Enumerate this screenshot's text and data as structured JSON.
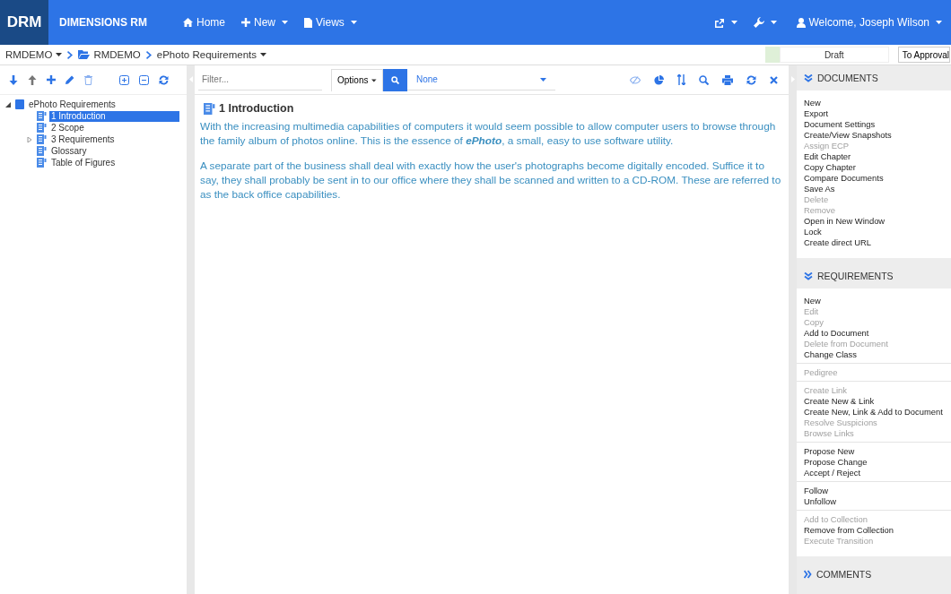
{
  "app": {
    "logo": "DRM",
    "product": "DIMENSIONS RM"
  },
  "nav": [
    {
      "kind": "home",
      "label": "Home",
      "dropdown": false
    },
    {
      "kind": "new",
      "label": "New",
      "dropdown": true
    },
    {
      "kind": "views",
      "label": "Views",
      "dropdown": true
    }
  ],
  "nav_right": [
    {
      "kind": "share",
      "dropdown": true
    },
    {
      "kind": "tools",
      "dropdown": true
    }
  ],
  "user": {
    "label": "Welcome, Joseph Wilson",
    "dropdown": true
  },
  "breadcrumb": [
    {
      "kind": "project",
      "label": "RMDEMO",
      "dropdown": true
    },
    {
      "kind": "folder",
      "label": "RMDEMO",
      "dropdown": false
    },
    {
      "kind": "document",
      "label": "ePhoto Requirements",
      "dropdown": true
    }
  ],
  "status": {
    "state": "Draft",
    "action": "To Approval",
    "color": "#dff0d8"
  },
  "tree": [
    {
      "label": "ePhoto Requirements",
      "expanded": true,
      "selected": false,
      "children": [
        {
          "label": "1 Introduction",
          "selected": true
        },
        {
          "label": "2 Scope",
          "selected": false
        },
        {
          "label": "3 Requirements",
          "expanded": false,
          "selected": false
        },
        {
          "label": "Glossary",
          "selected": false
        },
        {
          "label": "Table of Figures",
          "selected": false
        }
      ]
    }
  ],
  "filter": {
    "placeholder": "Filter..."
  },
  "options_button": "Options",
  "view_select": "None",
  "content": {
    "heading": "1 Introduction",
    "paragraphs": [
      "With the increasing multimedia capabilities of computers it would seem possible to allow computer users to browse through the family album of photos online. This is the essence of *ePhoto*, a small, easy to use software utility.",
      "A separate part of the business shall deal with exactly how the user's photographs become digitally encoded. Suffice it to say, they shall probably be sent in to our office where they shall be scanned and written to a CD-ROM. These are referred to as the back office capabilities."
    ]
  },
  "panels": [
    {
      "title": "DOCUMENTS",
      "expanded": true,
      "groups": [
        [
          {
            "label": "New",
            "disabled": false
          },
          {
            "label": "Export",
            "disabled": false
          },
          {
            "label": "Document Settings",
            "disabled": false
          },
          {
            "label": "Create/View Snapshots",
            "disabled": false
          },
          {
            "label": "Assign ECP",
            "disabled": true
          },
          {
            "label": "Edit Chapter",
            "disabled": false
          },
          {
            "label": "Copy Chapter",
            "disabled": false
          },
          {
            "label": "Compare Documents",
            "disabled": false
          },
          {
            "label": "Save As",
            "disabled": false
          },
          {
            "label": "Delete",
            "disabled": true
          },
          {
            "label": "Remove",
            "disabled": true
          },
          {
            "label": "Open in New Window",
            "disabled": false
          },
          {
            "label": "Lock",
            "disabled": false
          },
          {
            "label": "Create direct URL",
            "disabled": false
          }
        ]
      ]
    },
    {
      "title": "REQUIREMENTS",
      "expanded": true,
      "groups": [
        [
          {
            "label": "New",
            "disabled": false
          },
          {
            "label": "Edit",
            "disabled": true
          },
          {
            "label": "Copy",
            "disabled": true
          },
          {
            "label": "Add to Document",
            "disabled": false
          },
          {
            "label": "Delete from Document",
            "disabled": true
          },
          {
            "label": "Change Class",
            "disabled": false
          }
        ],
        [
          {
            "label": "Pedigree",
            "disabled": true
          }
        ],
        [
          {
            "label": "Create Link",
            "disabled": true
          },
          {
            "label": "Create New & Link",
            "disabled": false
          },
          {
            "label": "Create New, Link & Add to Document",
            "disabled": false
          },
          {
            "label": "Resolve Suspicions",
            "disabled": true
          },
          {
            "label": "Browse Links",
            "disabled": true
          }
        ],
        [
          {
            "label": "Propose New",
            "disabled": false
          },
          {
            "label": "Propose Change",
            "disabled": false
          },
          {
            "label": "Accept / Reject",
            "disabled": false
          }
        ],
        [
          {
            "label": "Follow",
            "disabled": false
          },
          {
            "label": "Unfollow",
            "disabled": false
          }
        ],
        [
          {
            "label": "Add to Collection",
            "disabled": true
          },
          {
            "label": "Remove from Collection",
            "disabled": false
          },
          {
            "label": "Execute Transition",
            "disabled": true
          }
        ]
      ]
    },
    {
      "title": "COMMENTS",
      "expanded": false
    }
  ]
}
